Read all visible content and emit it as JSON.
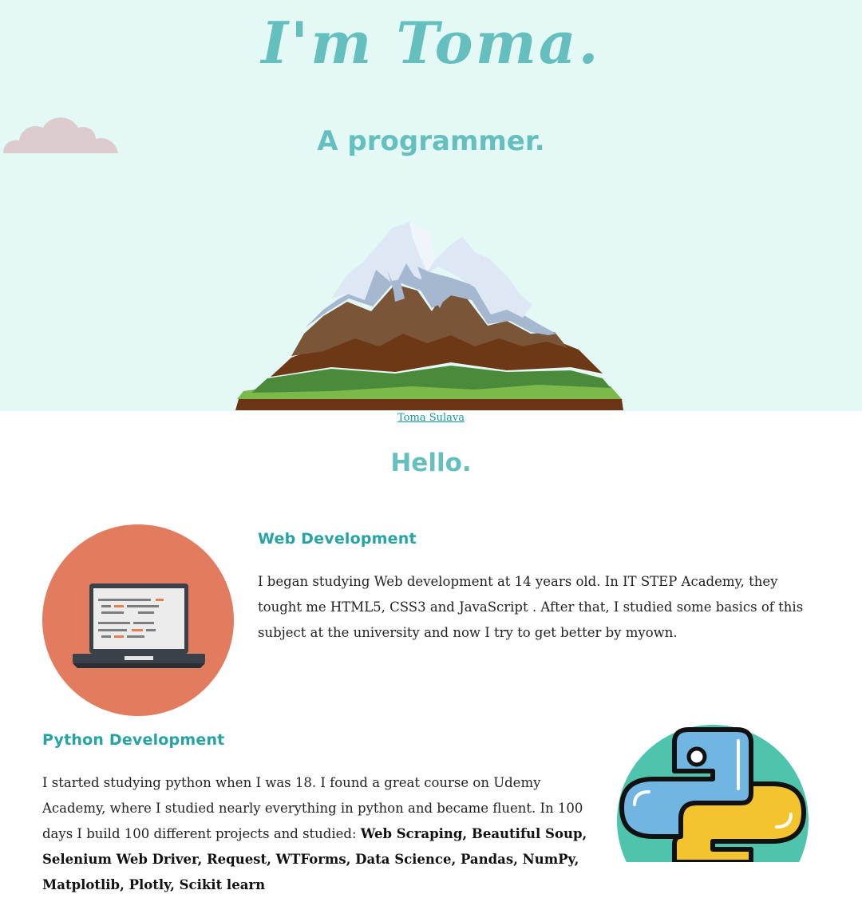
{
  "hero": {
    "title": "I'm Toma.",
    "subtitle": "A programmer."
  },
  "author_link": "Toma Sulava",
  "intro": {
    "heading": "Hello."
  },
  "skills": {
    "web": {
      "heading": "Web Development",
      "text": "I began studying Web development at 14 years old. In IT STEP Academy, they tought me HTML5, CSS3 and JavaScript . After that, I studied some basics of this subject at the university and now I try to get better by myown."
    },
    "python": {
      "heading": "Python Development",
      "text_plain": "I started studying python when I was 18. I found a great course on Udemy Academy, where I studied nearly everything in python and became fluent. In 100 days I build 100 different projects and studied: ",
      "text_bold": "Web Scraping, Beautiful Soup, Selenium Web Driver, Request, WTForms, Data Science, Pandas, NumPy, Matplotlib, Plotly, Scikit learn"
    }
  },
  "colors": {
    "hero_bg": "#e4f9f5",
    "accent": "#66bfbf",
    "heading": "#26a3a6",
    "link": "#11999e",
    "web_circle": "#e37b5e",
    "python_circle": "#4ec4ad"
  },
  "icons": {
    "cloud": "cloud-icon",
    "mountain": "mountain-icon",
    "laptop": "laptop-icon",
    "python": "python-logo-icon"
  }
}
